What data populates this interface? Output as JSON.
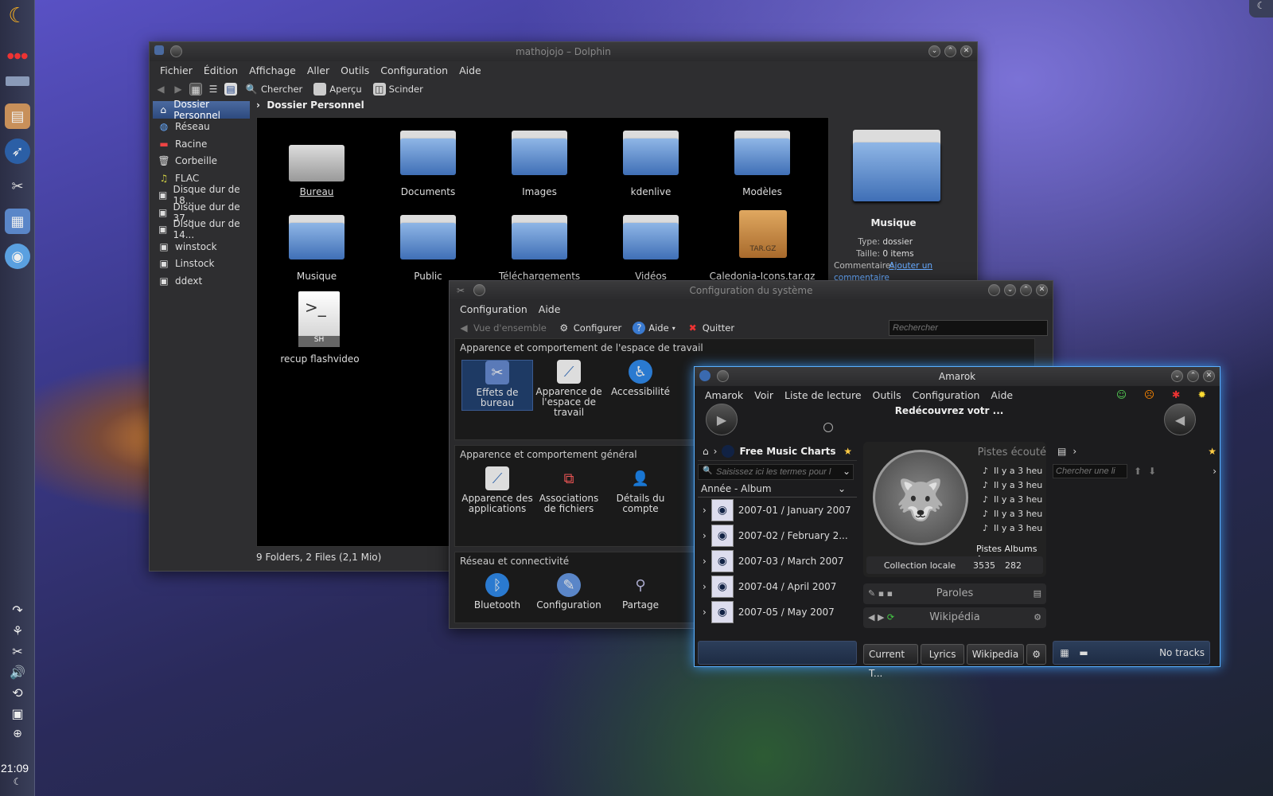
{
  "panel": {
    "clock": "21:09"
  },
  "dolphin": {
    "title": "mathojojo – Dolphin",
    "menu": [
      "Fichier",
      "Édition",
      "Affichage",
      "Aller",
      "Outils",
      "Configuration",
      "Aide"
    ],
    "toolbar": {
      "search": "Chercher",
      "preview": "Aperçu",
      "split": "Scinder"
    },
    "places": [
      "Dossier Personnel",
      "Réseau",
      "Racine",
      "Corbeille",
      "FLAC",
      "Disque dur de 18...",
      "Disque dur de 37...",
      "Disque dur de 14...",
      "winstock",
      "Linstock",
      "ddext"
    ],
    "breadcrumb": "Dossier Personnel",
    "items": [
      "Bureau",
      "Documents",
      "Images",
      "kdenlive",
      "Modèles",
      "Musique",
      "Public",
      "Téléchargements",
      "Vidéos",
      "Caledonia-Icons.tar.gz",
      "recup flashvideo"
    ],
    "archive_badge": "TAR.GZ",
    "script_badge": "SH",
    "script_prompt": ">_",
    "status": "9 Folders, 2 Files (2,1 Mio)",
    "info": {
      "name": "Musique",
      "type_label": "Type:",
      "type": "dossier",
      "size_label": "Taille:",
      "size": "0 items",
      "comment_label": "Commentaire:",
      "comment_link": "Ajouter un commentaire"
    }
  },
  "sysconf": {
    "title": "Configuration du système",
    "menu": [
      "Configuration",
      "Aide"
    ],
    "toolbar": {
      "overview": "Vue d'ensemble",
      "configure": "Configurer",
      "help": "Aide",
      "quit": "Quitter",
      "search_placeholder": "Rechercher"
    },
    "sections": [
      {
        "title": "Apparence et comportement de l'espace de travail",
        "items": [
          "Effets de bureau",
          "Apparence de l'espace de travail",
          "Accessibilité"
        ]
      },
      {
        "title": "Apparence et comportement général",
        "items": [
          "Apparence des applications",
          "Associations de fichiers",
          "Détails du compte"
        ]
      },
      {
        "title": "Réseau et connectivité",
        "items": [
          "Bluetooth",
          "Configuration",
          "Partage"
        ]
      }
    ]
  },
  "amarok": {
    "title": "Amarok",
    "menu": [
      "Amarok",
      "Voir",
      "Liste de lecture",
      "Outils",
      "Configuration",
      "Aide"
    ],
    "now_playing": "Redécouvrez votr ...",
    "source": "Free Music Charts",
    "search_placeholder": "Saisissez ici les termes pour l",
    "sort": "Année - Album",
    "albums": [
      "2007-01 / January 2007",
      "2007-02 / February 2...",
      "2007-03 / March 2007",
      "2007-04 / April 2007",
      "2007-05 / May 2007"
    ],
    "played_header": "Pistes écouté",
    "played": [
      "Il y a 3 heu",
      "Il y a 3 heu",
      "Il y a 3 heu",
      "Il y a 3 heu",
      "Il y a 3 heu"
    ],
    "stats_header": "Pistes Albums Ar",
    "collection_label": "Collection locale",
    "tracks_count": "3535",
    "albums_count": "282",
    "lyrics": "Paroles",
    "wikipedia": "Wikipédia",
    "tabs": [
      "Current T...",
      "Lyrics",
      "Wikipedia"
    ],
    "playlist_search": "Chercher une li",
    "no_tracks": "No tracks"
  }
}
